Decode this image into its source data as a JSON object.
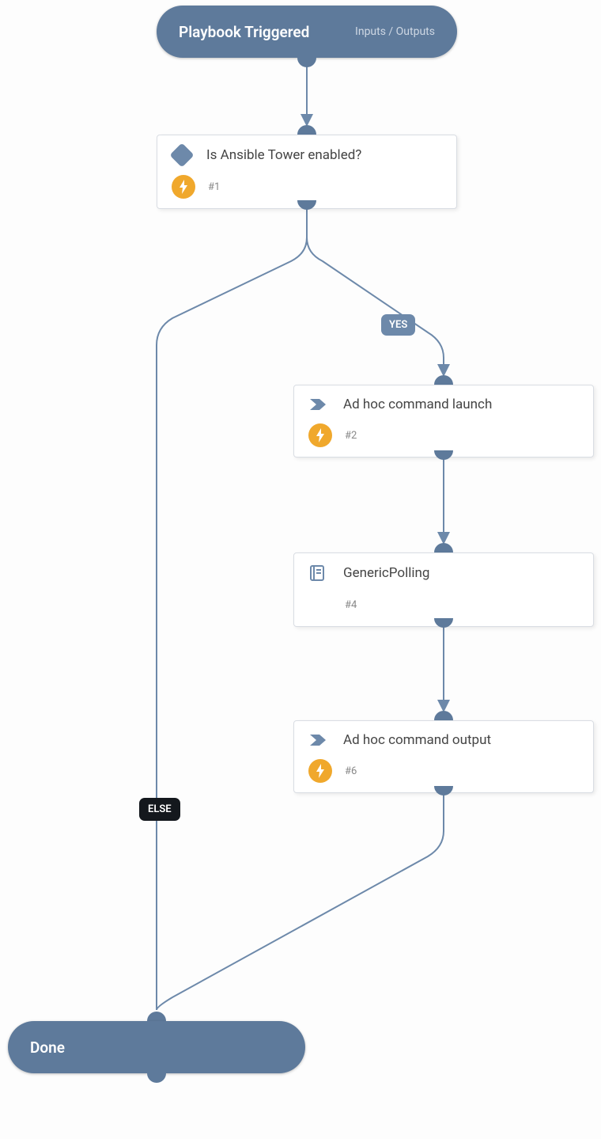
{
  "start": {
    "title": "Playbook Triggered",
    "io_label": "Inputs / Outputs"
  },
  "nodes": {
    "n1": {
      "title": "Is Ansible Tower enabled?",
      "num": "#1",
      "type": "condition",
      "has_bolt": true
    },
    "n2": {
      "title": "Ad hoc command launch",
      "num": "#2",
      "type": "chevron",
      "has_bolt": true
    },
    "n4": {
      "title": "GenericPolling",
      "num": "#4",
      "type": "book",
      "has_bolt": false
    },
    "n6": {
      "title": "Ad hoc command output",
      "num": "#6",
      "type": "chevron",
      "has_bolt": true
    }
  },
  "branches": {
    "yes": "YES",
    "else": "ELSE"
  },
  "end": {
    "title": "Done"
  }
}
